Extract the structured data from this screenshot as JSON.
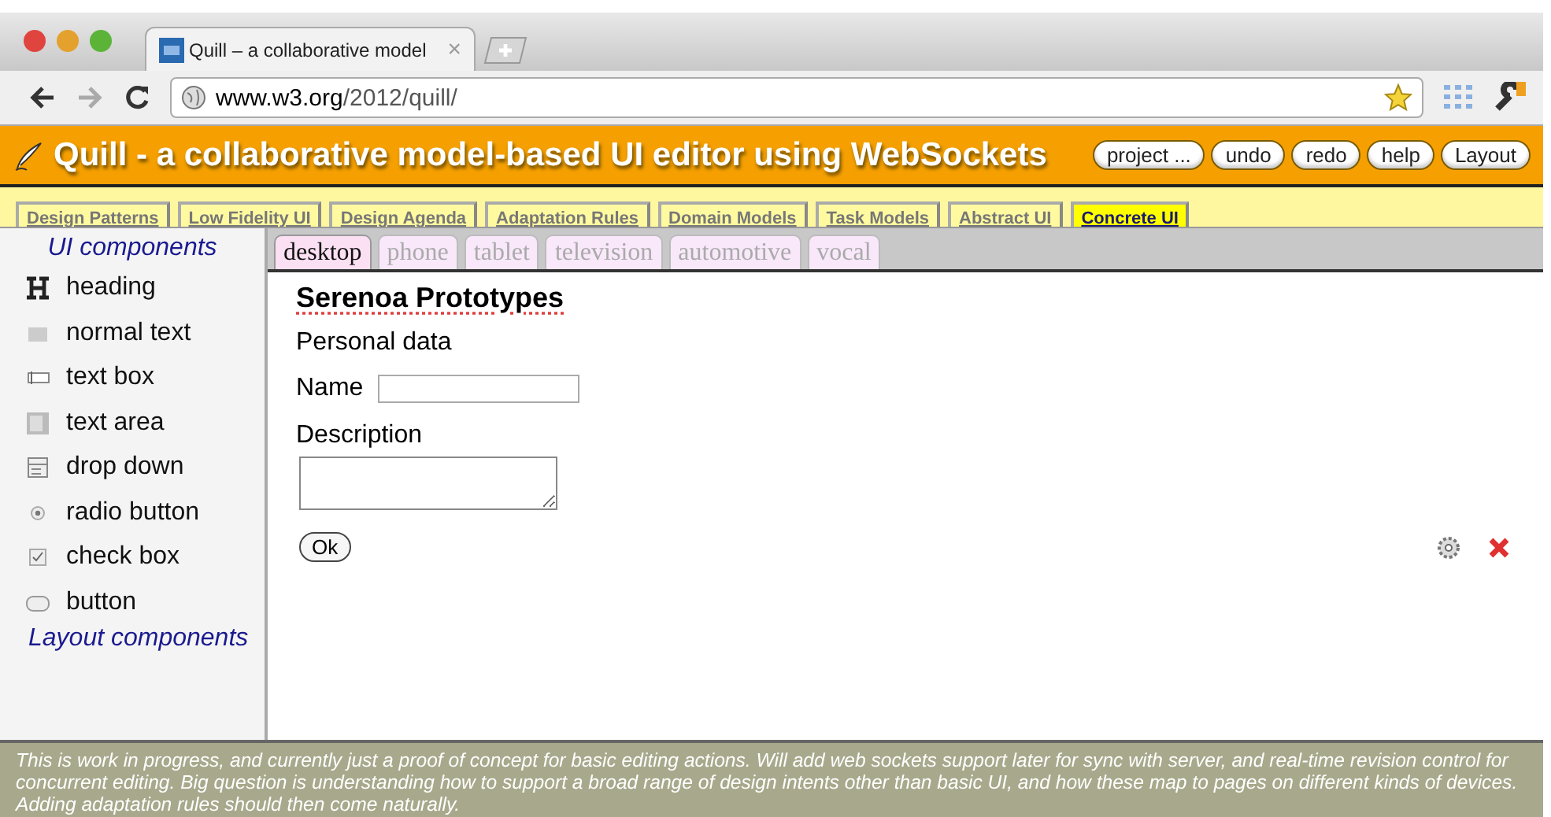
{
  "browser": {
    "tab_title": "Quill – a collaborative model",
    "tab_close": "×",
    "url_host": "www.w3.org",
    "url_path": "/2012/quill/"
  },
  "header": {
    "title": "Quill - a collaborative model-based UI editor using WebSockets",
    "buttons": [
      "project ...",
      "undo",
      "redo",
      "help",
      "Layout"
    ]
  },
  "nav_tabs": [
    {
      "label": "Design Patterns",
      "selected": false
    },
    {
      "label": "Low Fidelity UI",
      "selected": false
    },
    {
      "label": "Design Agenda",
      "selected": false
    },
    {
      "label": "Adaptation Rules",
      "selected": false
    },
    {
      "label": "Domain Models",
      "selected": false
    },
    {
      "label": "Task Models",
      "selected": false
    },
    {
      "label": "Abstract UI",
      "selected": false
    },
    {
      "label": "Concrete UI",
      "selected": true
    }
  ],
  "sidebar": {
    "heading": "UI components",
    "items": [
      {
        "kind": "heading",
        "label": "heading"
      },
      {
        "kind": "text",
        "label": "normal text"
      },
      {
        "kind": "textbox",
        "label": "text box"
      },
      {
        "kind": "textarea",
        "label": "text area"
      },
      {
        "kind": "dropdown",
        "label": "drop down"
      },
      {
        "kind": "radio",
        "label": "radio button"
      },
      {
        "kind": "checkbox",
        "label": "check box"
      },
      {
        "kind": "button",
        "label": "button"
      }
    ],
    "footer_heading": "Layout components"
  },
  "device_tabs": [
    {
      "label": "desktop",
      "selected": true
    },
    {
      "label": "phone",
      "selected": false
    },
    {
      "label": "tablet",
      "selected": false
    },
    {
      "label": "television",
      "selected": false
    },
    {
      "label": "automotive",
      "selected": false
    },
    {
      "label": "vocal",
      "selected": false
    }
  ],
  "canvas": {
    "title": "Serenoa Prototypes",
    "section": "Personal data",
    "name_label": "Name",
    "description_label": "Description",
    "button": "Ok"
  },
  "status_text": "This is work in progress, and currently just a proof of concept for basic editing actions. Will add web sockets support later for sync with server, and real-time revision control for concurrent editing. Big question is understanding how to support a broad range of design intents other than basic UI, and how these map to pages on different kinds of devices. Adding adaptation rules should then come naturally."
}
